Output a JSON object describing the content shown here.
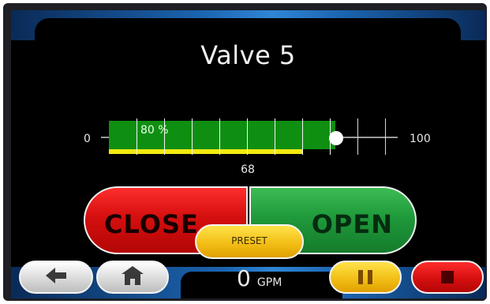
{
  "title": "Valve 5",
  "scale": {
    "min_label": "0",
    "max_label": "100"
  },
  "slider": {
    "fill_percent": 80,
    "percent_label": "80 %",
    "setpoint_percent": 70,
    "position_value": "68",
    "position_percent": 68
  },
  "buttons": {
    "close_label": "CLOSE",
    "open_label": "OPEN",
    "preset_label": "PRESET"
  },
  "flow": {
    "value": "0",
    "unit": "GPM"
  },
  "nav": {
    "back_icon": "arrow-left-icon",
    "home_icon": "home-icon",
    "pause_icon": "pause-icon",
    "stop_icon": "stop-icon"
  },
  "colors": {
    "fill": "#0f8f12",
    "position_bar": "#f2ea10",
    "close": "#d50f0f",
    "open": "#1f9a3b",
    "preset": "#f3bf17"
  }
}
